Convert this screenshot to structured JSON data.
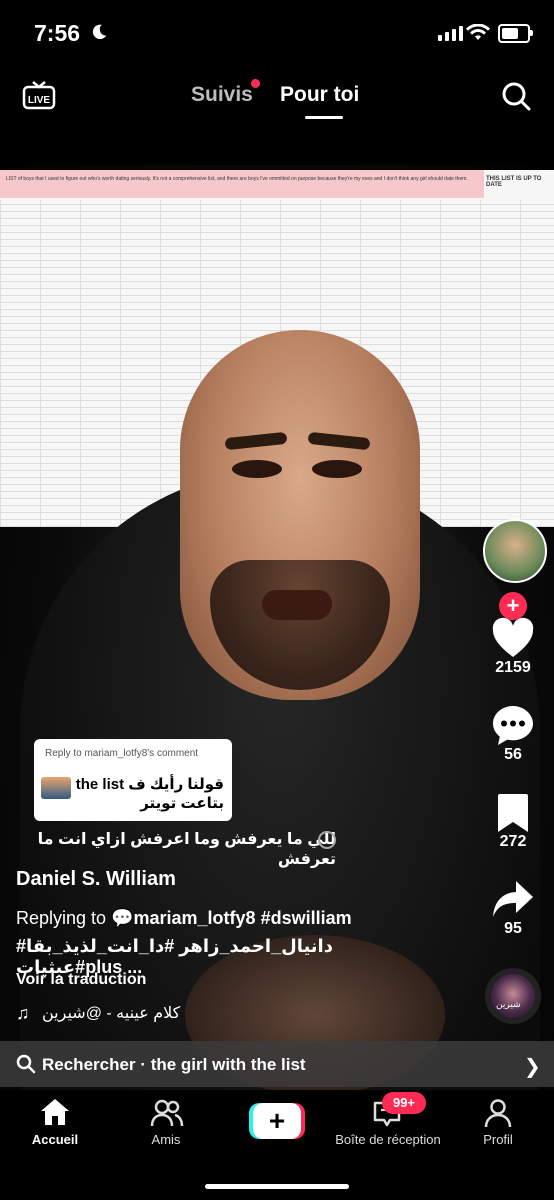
{
  "status_bar": {
    "time": "7:56"
  },
  "top_nav": {
    "following": "Suivis",
    "for_you": "Pour toi",
    "live": "LIVE"
  },
  "sheet": {
    "banner": "LIST of boys that I used to figure out who's worth dating seriously. It's not a comprehensive list, and there are boys I've ommitted on purpose because they're my exes and I don't think any girl should date them.",
    "right_header": "THIS LIST IS UP TO DATE"
  },
  "reply_card": {
    "header": "Reply to mariam_lotfy8's comment",
    "text": "قولنا رأيك ف the list بتاعت تويتر"
  },
  "caption_arabic": "للي ما يعرفش وما اعرفش ازاي انت ما تعرفش",
  "author": "Daniel S. William",
  "replying": {
    "prefix": "Replying to",
    "user": "mariam_lotfy8",
    "tag": "#dswilliam"
  },
  "hashtags": "#دانيال_احمد_زاهر #دا_انت_لذيذ_بقا #عبثياتplus ...",
  "translate": "Voir la traduction",
  "sound": "كلام عينيه - @شيرين",
  "rail": {
    "likes": "2159",
    "comments": "56",
    "saves": "272",
    "shares": "95",
    "music_label": "شيرين"
  },
  "search_bar": {
    "prefix": "Rechercher",
    "separator": "·",
    "query": "the girl with the list"
  },
  "bottom_nav": {
    "home": "Accueil",
    "friends": "Amis",
    "inbox": "Boîte de réception",
    "inbox_badge": "99+",
    "profile": "Profil"
  }
}
